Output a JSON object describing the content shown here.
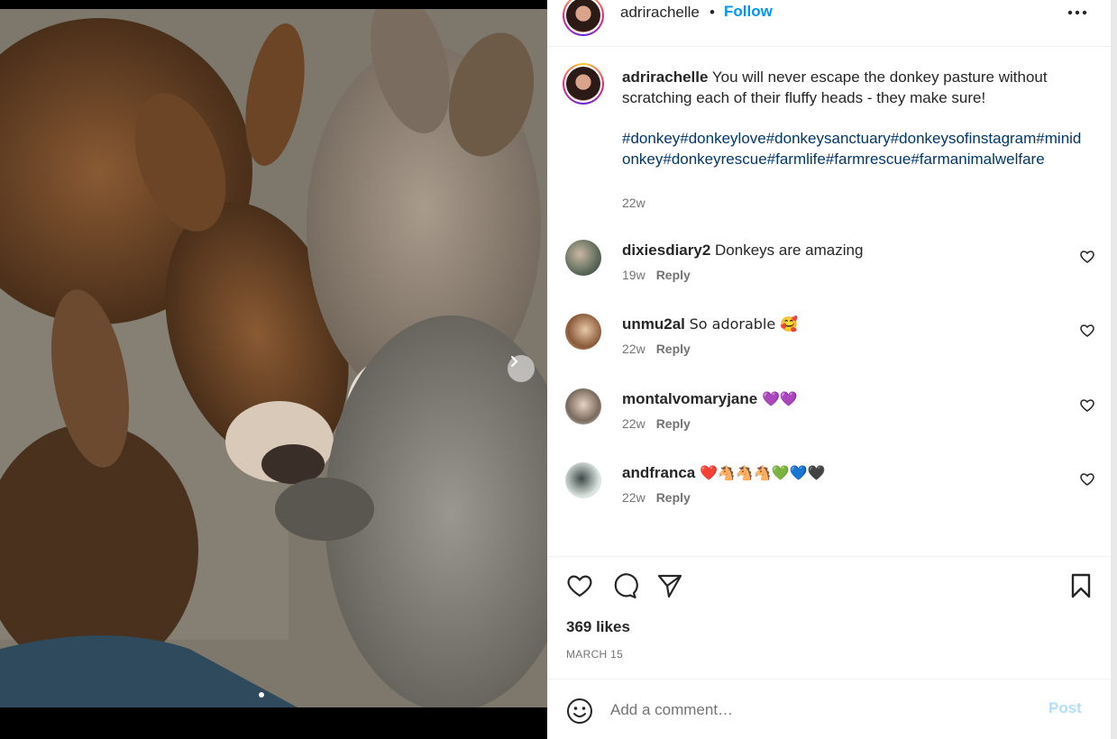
{
  "post": {
    "username": "adrirachelle",
    "separator": "•",
    "follow_label": "Follow",
    "more_icon": "more-horizontal-icon",
    "image_alt": "Three fluffy donkeys nuzzling together",
    "carousel_next_icon": "chevron-right-icon"
  },
  "caption": {
    "username": "adrirachelle",
    "text": "You will never escape the donkey pasture without scratching each of their fluffy heads - they make sure!",
    "hashtags": "#donkey#donkeylove#donkeysanctuary#donkeysofinstagram#minidonkey#donkeyrescue#farmlife#farmrescue#farmanimalwelfare",
    "time": "22w"
  },
  "comments": [
    {
      "username": "dixiesdiary2",
      "text": "Donkeys are amazing",
      "time": "19w",
      "reply": "Reply"
    },
    {
      "username": "unmu2al",
      "text": "So adorable 🥰",
      "time": "22w",
      "reply": "Reply"
    },
    {
      "username": "montalvomaryjane",
      "text": "💜💜",
      "time": "22w",
      "reply": "Reply"
    },
    {
      "username": "andfranca",
      "text": "❤️🐴🐴🐴💚💙🖤",
      "time": "22w",
      "reply": "Reply"
    }
  ],
  "actions": {
    "like_icon": "heart-icon",
    "comment_icon": "comment-icon",
    "share_icon": "send-icon",
    "save_icon": "bookmark-icon"
  },
  "likes": "369 likes",
  "date": "MARCH 15",
  "add_comment": {
    "emoji_icon": "smiley-icon",
    "placeholder": "Add a comment…",
    "post_label": "Post"
  },
  "colors": {
    "link_blue": "#0095f6",
    "hashtag": "#00376b",
    "muted": "#737373",
    "post_disabled": "#b2dffc"
  }
}
